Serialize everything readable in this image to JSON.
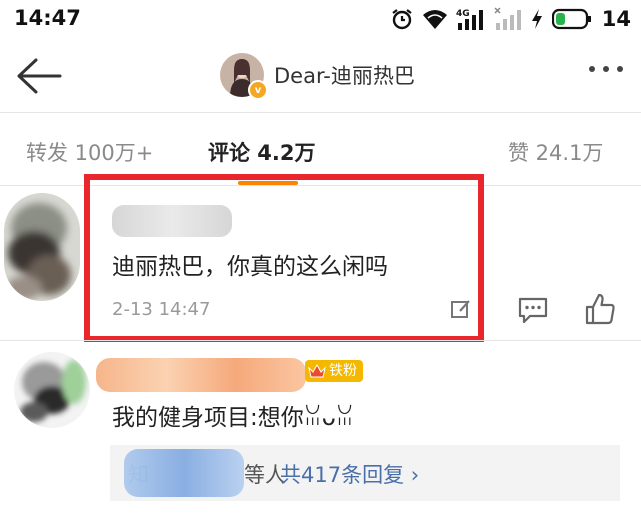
{
  "status_bar": {
    "time": "14:47",
    "battery_level": "14",
    "icons": [
      "alarm-icon",
      "wifi-icon",
      "signal-4g-icon",
      "signal-icon",
      "charging-icon",
      "battery-icon"
    ]
  },
  "nav": {
    "title": "Dear-迪丽热巴",
    "verified_badge": "v"
  },
  "tabs": [
    {
      "label": "转发 100万+",
      "active": false
    },
    {
      "label": "评论 4.2万",
      "active": true
    },
    {
      "label": "赞 24.1万",
      "active": false
    }
  ],
  "comments": [
    {
      "text": "迪丽热巴，你真的这么闲吗",
      "time": "2-13 14:47"
    },
    {
      "badge": "铁粉",
      "text": "我的健身项目:想你ꈍᴗꈍ",
      "reply_prefix": "知",
      "reply_suffix": "等人",
      "reply_count": "共417条回复 ›"
    }
  ],
  "colors": {
    "accent": "#ff8200",
    "highlight": "#e8262c",
    "link": "#4a6fa8",
    "badge": "#f5b800"
  }
}
